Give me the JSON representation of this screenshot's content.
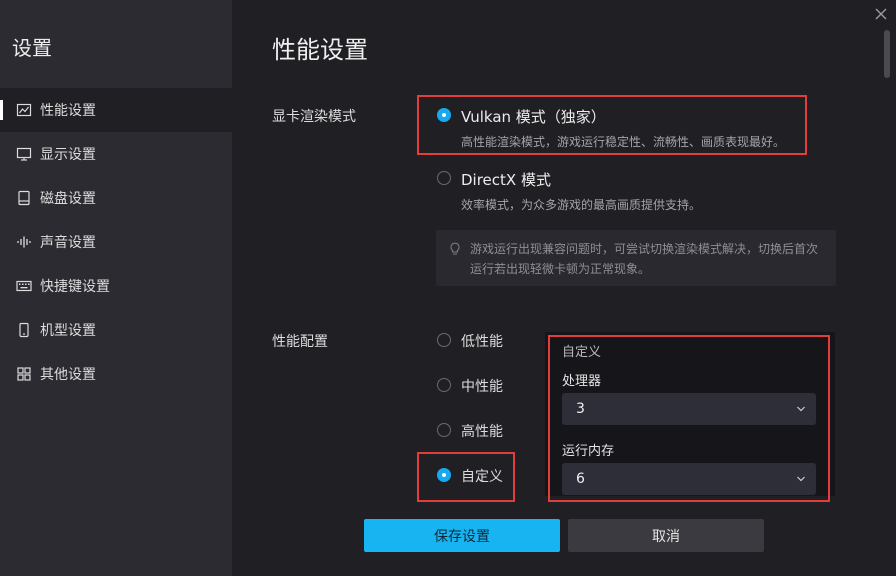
{
  "sidebar": {
    "title": "设置",
    "items": [
      {
        "label": "性能设置",
        "icon": "chart-icon",
        "active": true
      },
      {
        "label": "显示设置",
        "icon": "monitor-icon",
        "active": false
      },
      {
        "label": "磁盘设置",
        "icon": "disk-icon",
        "active": false
      },
      {
        "label": "声音设置",
        "icon": "sound-wave-icon",
        "active": false
      },
      {
        "label": "快捷键设置",
        "icon": "keyboard-icon",
        "active": false
      },
      {
        "label": "机型设置",
        "icon": "phone-icon",
        "active": false
      },
      {
        "label": "其他设置",
        "icon": "grid-icon",
        "active": false
      }
    ]
  },
  "main": {
    "title": "性能设置",
    "render_mode": {
      "label": "显卡渲染模式",
      "options": [
        {
          "title": "Vulkan 模式（独家）",
          "desc": "高性能渲染模式，游戏运行稳定性、流畅性、画质表现最好。",
          "checked": true
        },
        {
          "title": "DirectX 模式",
          "desc": "效率模式，为众多游戏的最高画质提供支持。",
          "checked": false
        }
      ],
      "tip": "游戏运行出现兼容问题时，可尝试切换渲染模式解决，切换后首次运行若出现轻微卡顿为正常现象。"
    },
    "perf_config": {
      "label": "性能配置",
      "options": [
        {
          "label": "低性能",
          "checked": false
        },
        {
          "label": "中性能",
          "checked": false
        },
        {
          "label": "高性能",
          "checked": false
        },
        {
          "label": "自定义",
          "checked": true
        }
      ],
      "custom": {
        "title": "自定义",
        "cpu_label": "处理器",
        "cpu_value": "3",
        "ram_label": "运行内存",
        "ram_value": "6"
      }
    },
    "buttons": {
      "save": "保存设置",
      "cancel": "取消"
    }
  },
  "colors": {
    "accent": "#16a9f0",
    "highlight_box": "#e23c3c"
  }
}
